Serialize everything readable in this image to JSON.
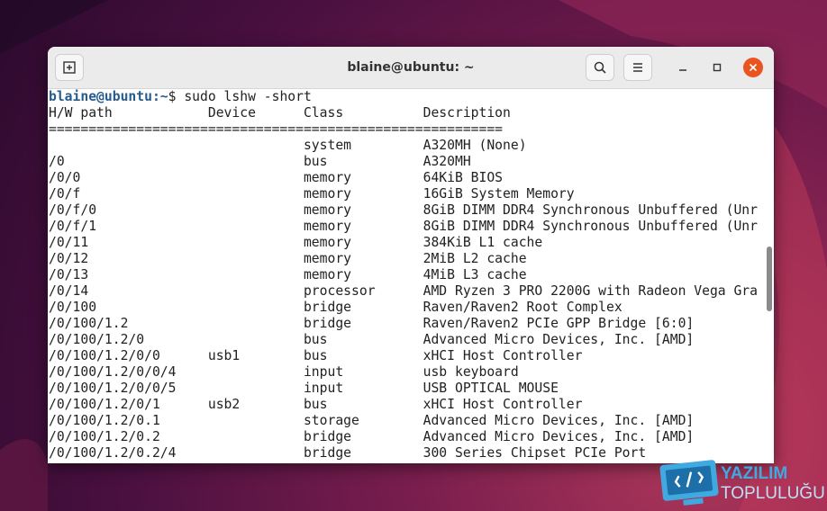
{
  "window": {
    "title": "blaine@ubuntu: ~"
  },
  "terminal": {
    "prompt_user": "blaine@ubuntu",
    "prompt_path": ":~",
    "prompt_symbol": "$ ",
    "command": "sudo lshw -short",
    "header": "H/W path            Device      Class          Description",
    "separator": "=========================================================",
    "rows": [
      "                                system         A320MH (None)",
      "/0                              bus            A320MH",
      "/0/0                            memory         64KiB BIOS",
      "/0/f                            memory         16GiB System Memory",
      "/0/f/0                          memory         8GiB DIMM DDR4 Synchronous Unbuffered (Unr",
      "/0/f/1                          memory         8GiB DIMM DDR4 Synchronous Unbuffered (Unr",
      "/0/11                           memory         384KiB L1 cache",
      "/0/12                           memory         2MiB L2 cache",
      "/0/13                           memory         4MiB L3 cache",
      "/0/14                           processor      AMD Ryzen 3 PRO 2200G with Radeon Vega Gra",
      "/0/100                          bridge         Raven/Raven2 Root Complex",
      "/0/100/1.2                      bridge         Raven/Raven2 PCIe GPP Bridge [6:0]",
      "/0/100/1.2/0                    bus            Advanced Micro Devices, Inc. [AMD]",
      "/0/100/1.2/0/0      usb1        bus            xHCI Host Controller",
      "/0/100/1.2/0/0/4                input          usb keyboard",
      "/0/100/1.2/0/0/5                input          USB OPTICAL MOUSE",
      "/0/100/1.2/0/1      usb2        bus            xHCI Host Controller",
      "/0/100/1.2/0.1                  storage        Advanced Micro Devices, Inc. [AMD]",
      "/0/100/1.2/0.2                  bridge         Advanced Micro Devices, Inc. [AMD]",
      "/0/100/1.2/0.2/4                bridge         300 Series Chipset PCIe Port"
    ]
  },
  "watermark": {
    "line1": "YAZILIM",
    "line2": "TOPLULUĞU"
  },
  "colors": {
    "close": "#e95420",
    "prompt": "#265b8d"
  }
}
